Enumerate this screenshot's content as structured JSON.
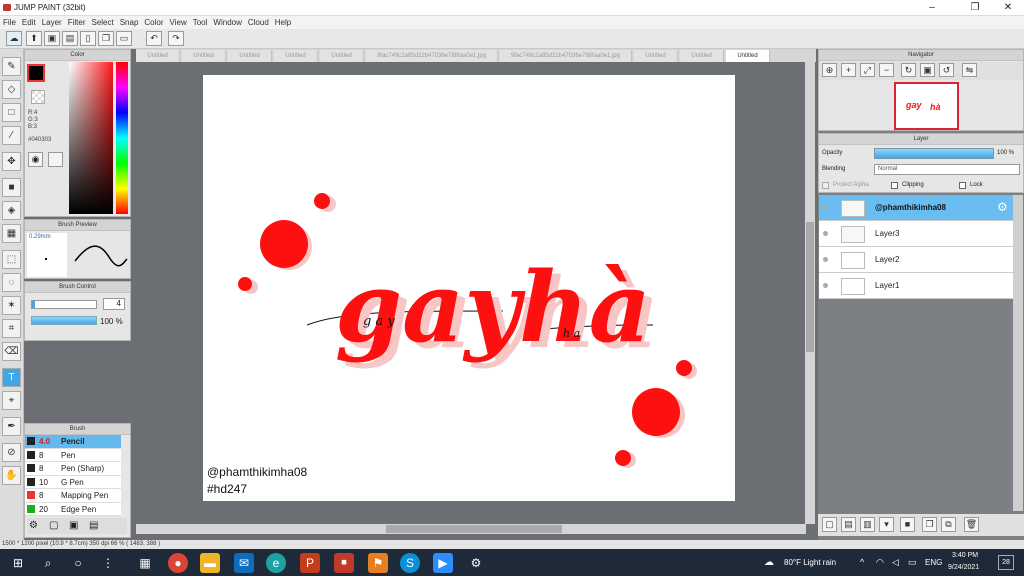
{
  "app": {
    "title": "JUMP PAINT (32bit)",
    "accent": "#3ea7e6"
  },
  "menu": [
    "File",
    "Edit",
    "Layer",
    "Filter",
    "Select",
    "Snap",
    "Color",
    "View",
    "Tool",
    "Window",
    "Cloud",
    "Help"
  ],
  "color_panel": {
    "title": "Color",
    "r": "R:4",
    "g": "G:3",
    "b": "B:3",
    "hex": "#040303"
  },
  "brush_preview": {
    "title": "Brush Preview",
    "size": "0.29mm"
  },
  "brush_control": {
    "title": "Brush Control",
    "size": "4",
    "opacity": "100 %"
  },
  "brush": {
    "title": "Brush",
    "items": [
      {
        "size": "4.0",
        "name": "Pencil",
        "color": "#222222"
      },
      {
        "size": "8",
        "name": "Pen",
        "color": "#222222"
      },
      {
        "size": "8",
        "name": "Pen (Sharp)",
        "color": "#222222"
      },
      {
        "size": "10",
        "name": "G Pen",
        "color": "#222222"
      },
      {
        "size": "8",
        "name": "Mapping Pen",
        "color": "#ee3333"
      },
      {
        "size": "20",
        "name": "Edge Pen",
        "color": "#22aa22"
      }
    ]
  },
  "tabs": [
    "Untitled",
    "Untitled",
    "Untitled",
    "Untitled",
    "Untitled",
    "9fac749c2a85d22b47036e788faa0e1.jpg",
    "9fac749c2a85d22b47036e788faa0e1.jpg",
    "Untitled",
    "Untitled",
    "Untitled"
  ],
  "artwork": {
    "word1": "gay",
    "word2": "hà",
    "script1": "g a y",
    "script2": "h a",
    "handle": "@phamthikimha08",
    "tag": "#hd247",
    "red": "#ff1010",
    "pink": "#f9c6c6"
  },
  "navigator": {
    "title": "Navigator"
  },
  "layer_panel": {
    "title": "Layer",
    "opacity_label": "Opacity",
    "opacity_value": "100 %",
    "blending_label": "Blending",
    "blending_value": "Normal",
    "protect_alpha": "Protect Alpha",
    "clipping": "Clipping",
    "lock": "Lock",
    "layers": [
      {
        "name": "@phamthikimha08"
      },
      {
        "name": "Layer3"
      },
      {
        "name": "Layer2"
      },
      {
        "name": "Layer1"
      }
    ]
  },
  "status": "1500 * 1200 pixel  (10.9 * 8.7cm)  350 dpi  66 %  ( 1483, 388 )",
  "taskbar": {
    "weather": "80°F  Light rain",
    "lang": "ENG",
    "time": "3:40 PM",
    "date": "9/24/2021",
    "notif": "28"
  }
}
